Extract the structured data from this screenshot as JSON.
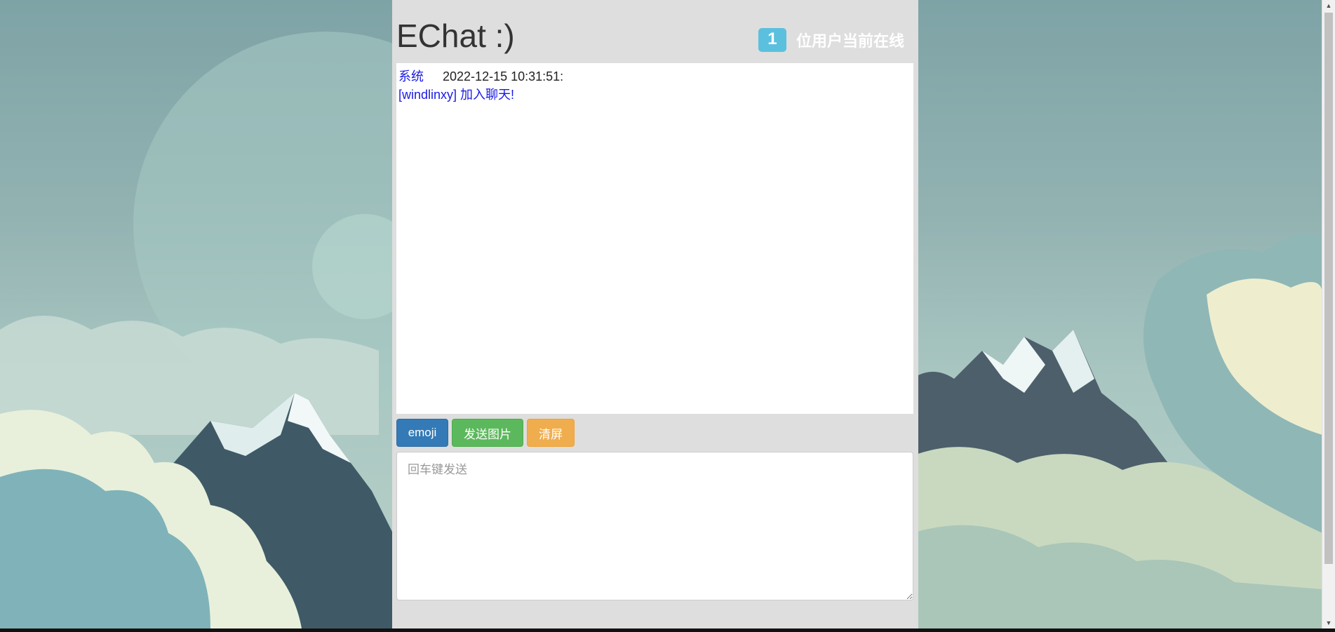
{
  "app": {
    "title": "EChat :)"
  },
  "header": {
    "online_count": "1",
    "online_label": "位用户当前在线"
  },
  "messages": [
    {
      "user": "系统",
      "time": "2022-12-15 10:31:51:",
      "text": "[windlinxy] 加入聊天!"
    }
  ],
  "toolbar": {
    "emoji_label": "emoji",
    "send_image_label": "发送图片",
    "clear_label": "清屏"
  },
  "input": {
    "value": "",
    "placeholder": "回车键发送"
  },
  "colors": {
    "panel_bg": "#dedede",
    "badge": "#5bc0de",
    "primary": "#337ab7",
    "success": "#5cb85c",
    "warning": "#f0ad4e",
    "system_text": "#1a1ae6"
  }
}
